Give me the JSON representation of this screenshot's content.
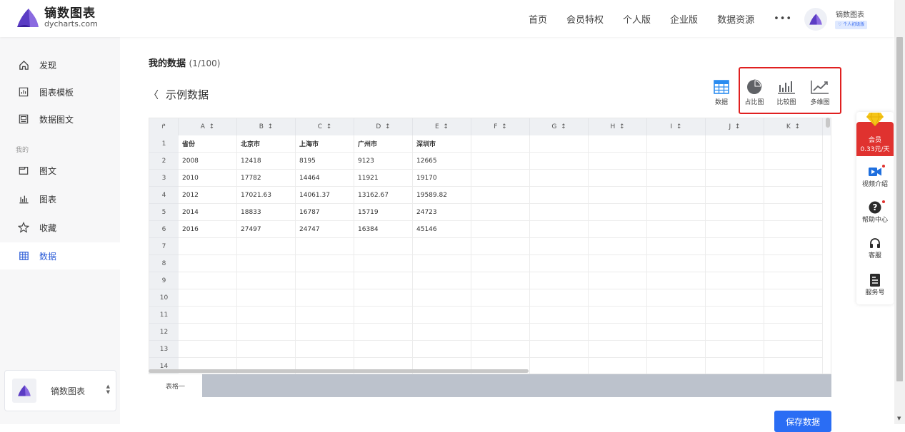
{
  "brand": {
    "name": "镝数图表",
    "domain": "dycharts.com"
  },
  "nav": [
    "首页",
    "会员特权",
    "个人版",
    "企业版",
    "数据资源",
    "•••"
  ],
  "user": {
    "name": "镝数图表",
    "badge": "个人初级版"
  },
  "sidebar": {
    "items": [
      {
        "label": "发现",
        "icon": "home-icon"
      },
      {
        "label": "图表模板",
        "icon": "chart-template-icon"
      },
      {
        "label": "数据图文",
        "icon": "data-article-icon"
      }
    ],
    "group_label": "我的",
    "my_items": [
      {
        "label": "图文",
        "icon": "article-icon"
      },
      {
        "label": "图表",
        "icon": "bar-chart-icon"
      },
      {
        "label": "收藏",
        "icon": "star-icon"
      },
      {
        "label": "数据",
        "icon": "table-icon"
      }
    ],
    "workspace": "镝数图表"
  },
  "page": {
    "title": "我的数据",
    "count": "(1/100)",
    "back_label": "示例数据"
  },
  "toolbar": {
    "data": "数据",
    "proportion": "占比图",
    "compare": "比较图",
    "multi": "多维图"
  },
  "table": {
    "columns": [
      "A",
      "B",
      "C",
      "D",
      "E",
      "F",
      "G",
      "H",
      "I",
      "J",
      "K"
    ],
    "rows": [
      "1",
      "2",
      "3",
      "4",
      "5",
      "6",
      "7",
      "8",
      "9",
      "10",
      "11",
      "12",
      "13",
      "14"
    ],
    "cells": [
      [
        "省份",
        "北京市",
        "上海市",
        "广州市",
        "深圳市"
      ],
      [
        "2008",
        "12418",
        "8195",
        "9123",
        "12665"
      ],
      [
        "2010",
        "17782",
        "14464",
        "11921",
        "19170"
      ],
      [
        "2012",
        "17021.63",
        "14061.37",
        "13162.67",
        "19589.82"
      ],
      [
        "2014",
        "18833",
        "16787",
        "15719",
        "24723"
      ],
      [
        "2016",
        "27497",
        "24747",
        "16384",
        "45146"
      ]
    ],
    "sheet_tab": "表格一"
  },
  "save_button": "保存数据",
  "right_panel": {
    "vip_line1": "会员",
    "vip_line2": "0.33元/天",
    "video": "视频介绍",
    "help": "帮助中心",
    "service": "客服",
    "account": "服务号"
  },
  "colors": {
    "accent": "#2a6df4",
    "vip_red": "#e0322f",
    "highlight_box": "#e02020"
  }
}
